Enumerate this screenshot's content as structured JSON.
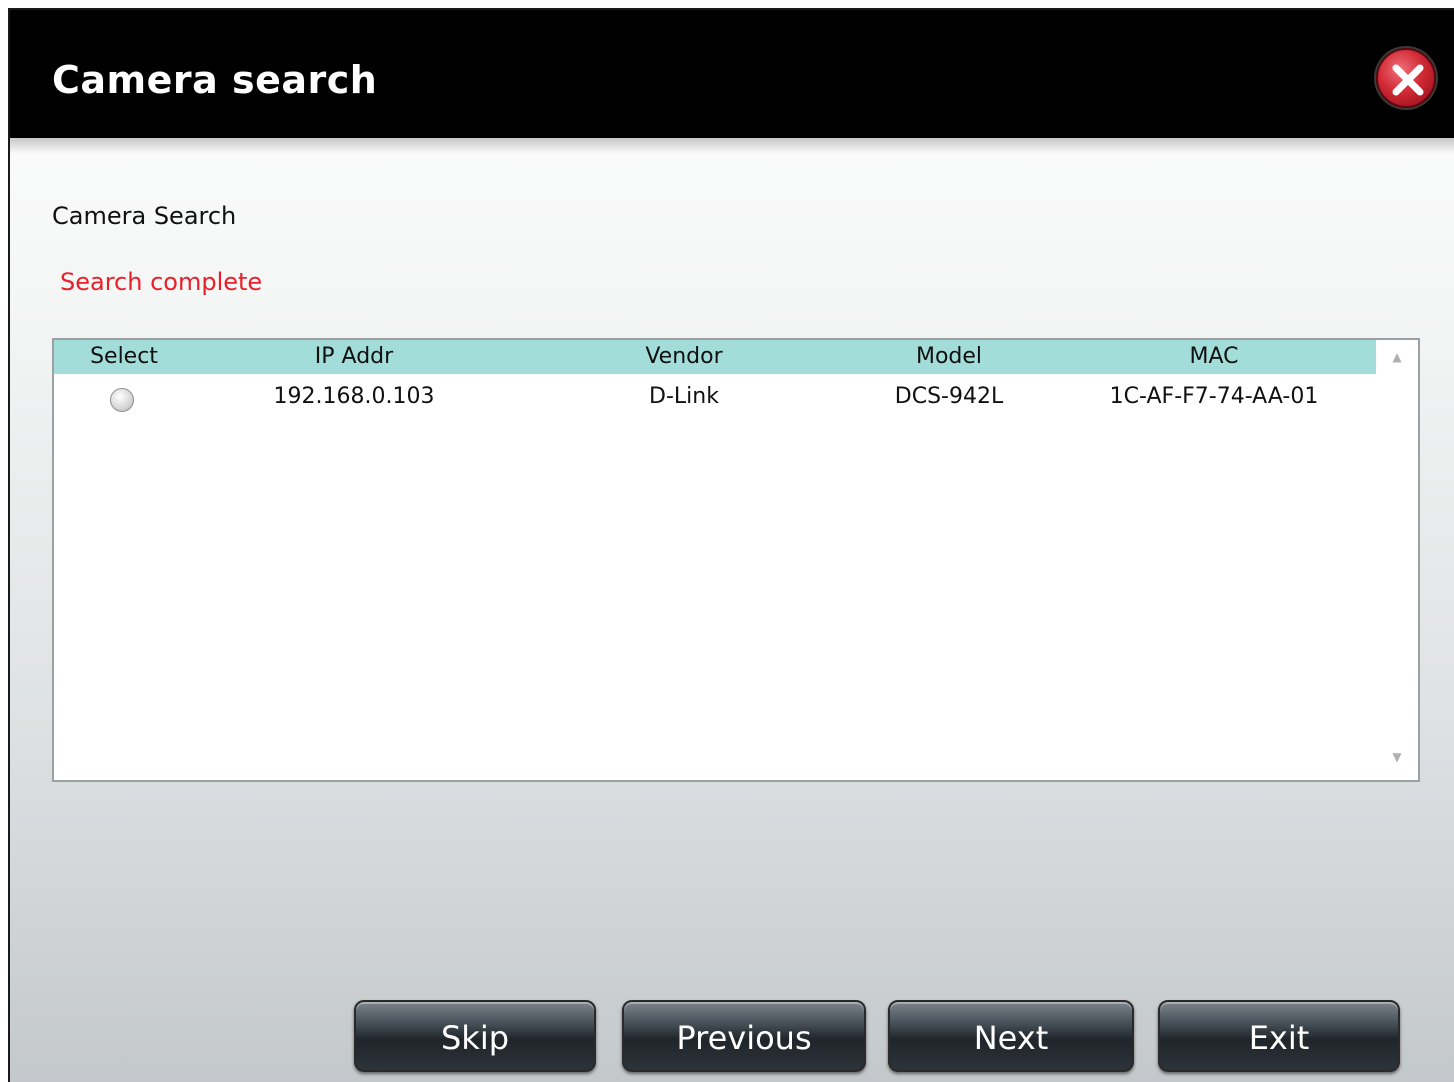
{
  "window": {
    "title": "Camera search"
  },
  "content": {
    "section_label": "Camera Search",
    "status": "Search complete"
  },
  "table": {
    "columns": [
      "Select",
      "IP Addr",
      "Vendor",
      "Model",
      "MAC"
    ],
    "rows": [
      {
        "selected": false,
        "ip": "192.168.0.103",
        "vendor": "D-Link",
        "model": "DCS-942L",
        "mac": "1C-AF-F7-74-AA-01"
      }
    ]
  },
  "buttons": {
    "skip": "Skip",
    "previous": "Previous",
    "next": "Next",
    "exit": "Exit"
  },
  "icons": {
    "close": "close-icon",
    "scroll_up": "scroll-up-icon",
    "scroll_down": "scroll-down-icon"
  },
  "colors": {
    "titlebar": "#000000",
    "status": "#e8202a",
    "table_header": "#a3ddd9",
    "close_button": "#d12a36"
  }
}
